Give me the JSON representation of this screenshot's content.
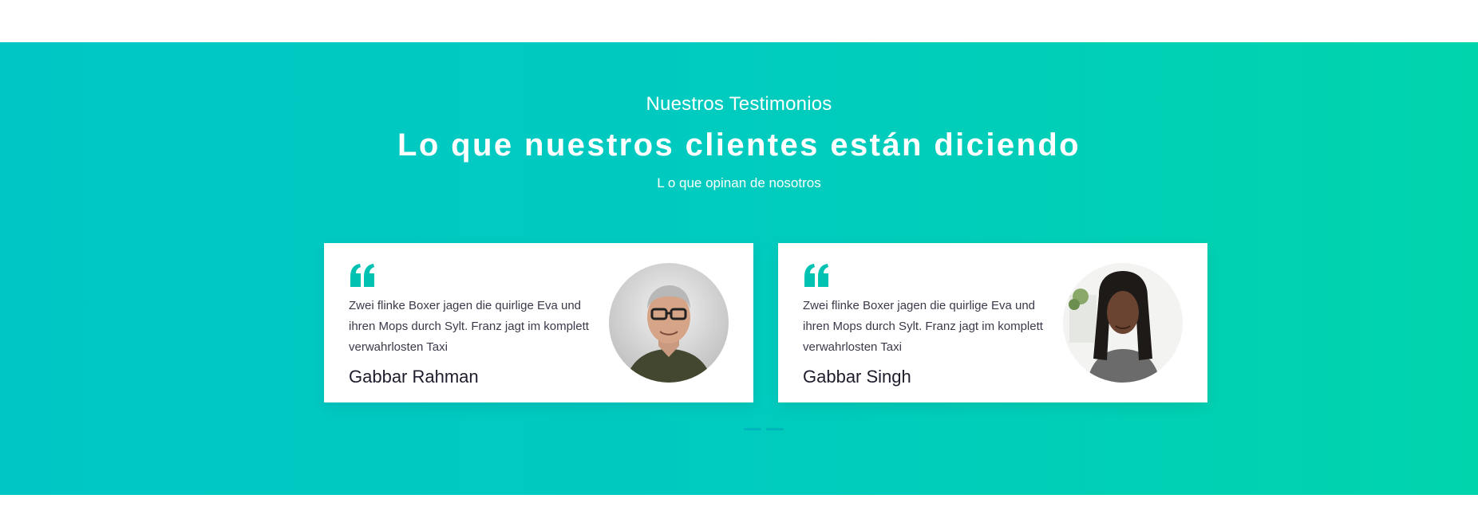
{
  "section": {
    "subtitle": "Nuestros Testimonios",
    "title": "Lo que nuestros clientes están diciendo",
    "tagline": "L o que opinan de nosotros",
    "colors": {
      "gradient_start": "#00c7c5",
      "gradient_end": "#00d4ad",
      "accent": "#00c2b2"
    }
  },
  "testimonials": [
    {
      "quote": "Zwei flinke Boxer jagen die quirlige Eva und ihren Mops durch Sylt. Franz jagt im komplett verwahrlosten Taxi",
      "name": "Gabbar Rahman",
      "avatar": "avatar-photo-man"
    },
    {
      "quote": "Zwei flinke Boxer jagen die quirlige Eva und ihren Mops durch Sylt. Franz jagt im komplett verwahrlosten Taxi",
      "name": "Gabbar Singh",
      "avatar": "avatar-photo-woman"
    }
  ],
  "pagination": {
    "count": 2
  }
}
